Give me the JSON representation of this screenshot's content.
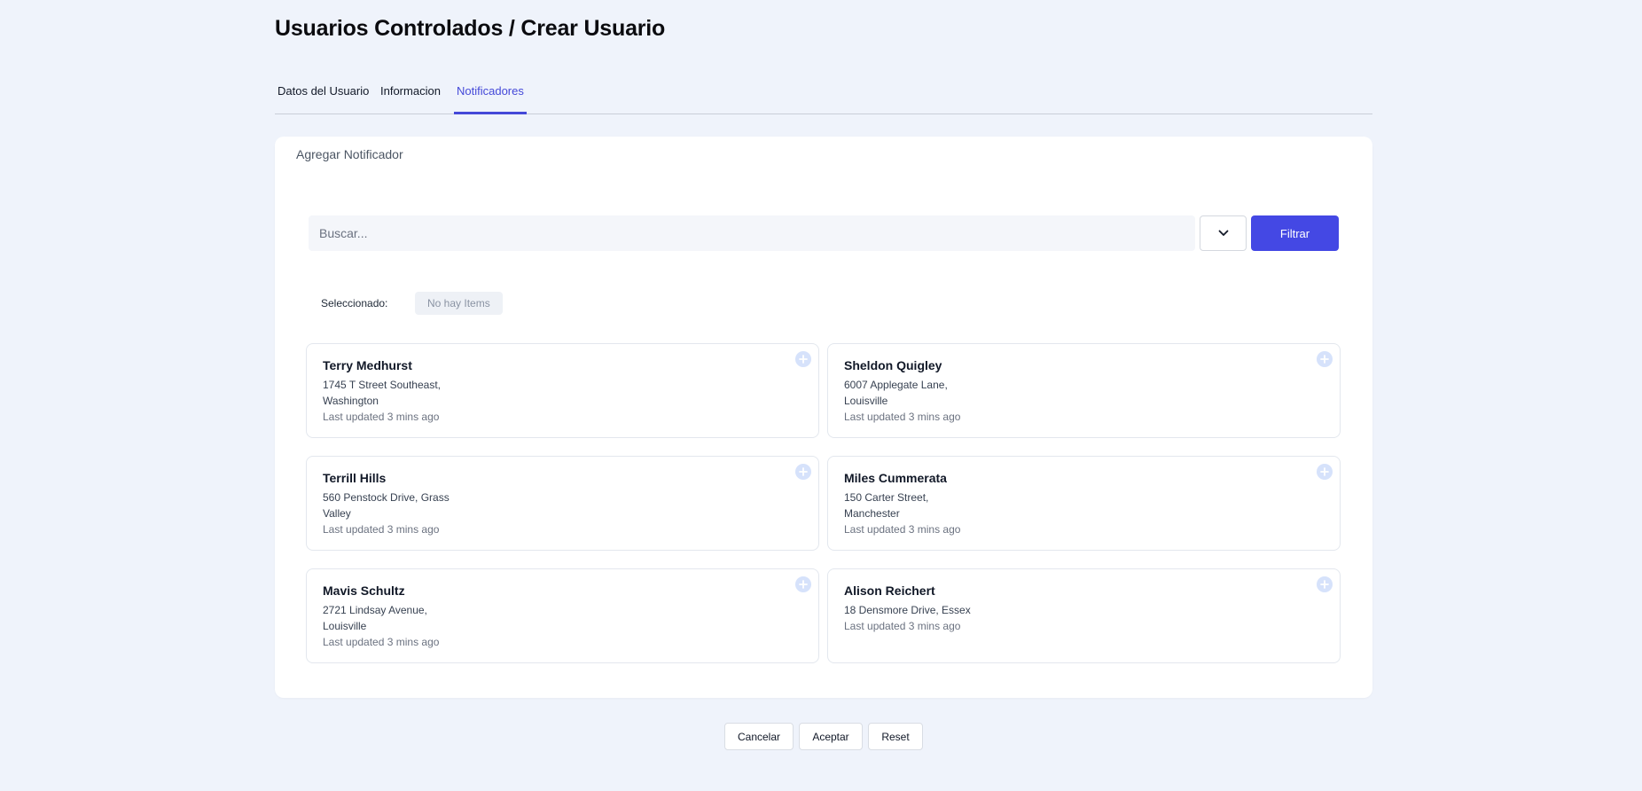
{
  "header": {
    "title": "Usuarios Controlados / Crear Usuario"
  },
  "tabs": [
    {
      "label": "Datos del Usuario",
      "active": false
    },
    {
      "label": "Informacion",
      "active": false
    },
    {
      "label": "Notificadores",
      "active": true
    }
  ],
  "panel": {
    "title": "Agregar Notificador",
    "search": {
      "placeholder": "Buscar...",
      "value": ""
    },
    "dropdown_icon": "chevron-down-icon",
    "filter_label": "Filtrar",
    "selected_label": "Seleccionado:",
    "selected_empty": "No hay Items"
  },
  "cards": [
    {
      "name": "Terry Medhurst",
      "address": "1745 T Street Southeast, Washington",
      "updated": "Last updated 3 mins ago"
    },
    {
      "name": "Sheldon Quigley",
      "address": "6007 Applegate Lane, Louisville",
      "updated": "Last updated 3 mins ago"
    },
    {
      "name": "Terrill Hills",
      "address": "560 Penstock Drive, Grass Valley",
      "updated": "Last updated 3 mins ago"
    },
    {
      "name": "Miles Cummerata",
      "address": "150 Carter Street, Manchester",
      "updated": "Last updated 3 mins ago"
    },
    {
      "name": "Mavis Schultz",
      "address": "2721 Lindsay Avenue, Louisville",
      "updated": "Last updated 3 mins ago"
    },
    {
      "name": "Alison Reichert",
      "address": "18 Densmore Drive, Essex",
      "updated": "Last updated 3 mins ago"
    }
  ],
  "footer": {
    "cancel_label": "Cancelar",
    "accept_label": "Aceptar",
    "reset_label": "Reset"
  },
  "colors": {
    "accent": "#4448e4",
    "background": "#eff3fb",
    "add_icon": "#d6e2fb"
  }
}
